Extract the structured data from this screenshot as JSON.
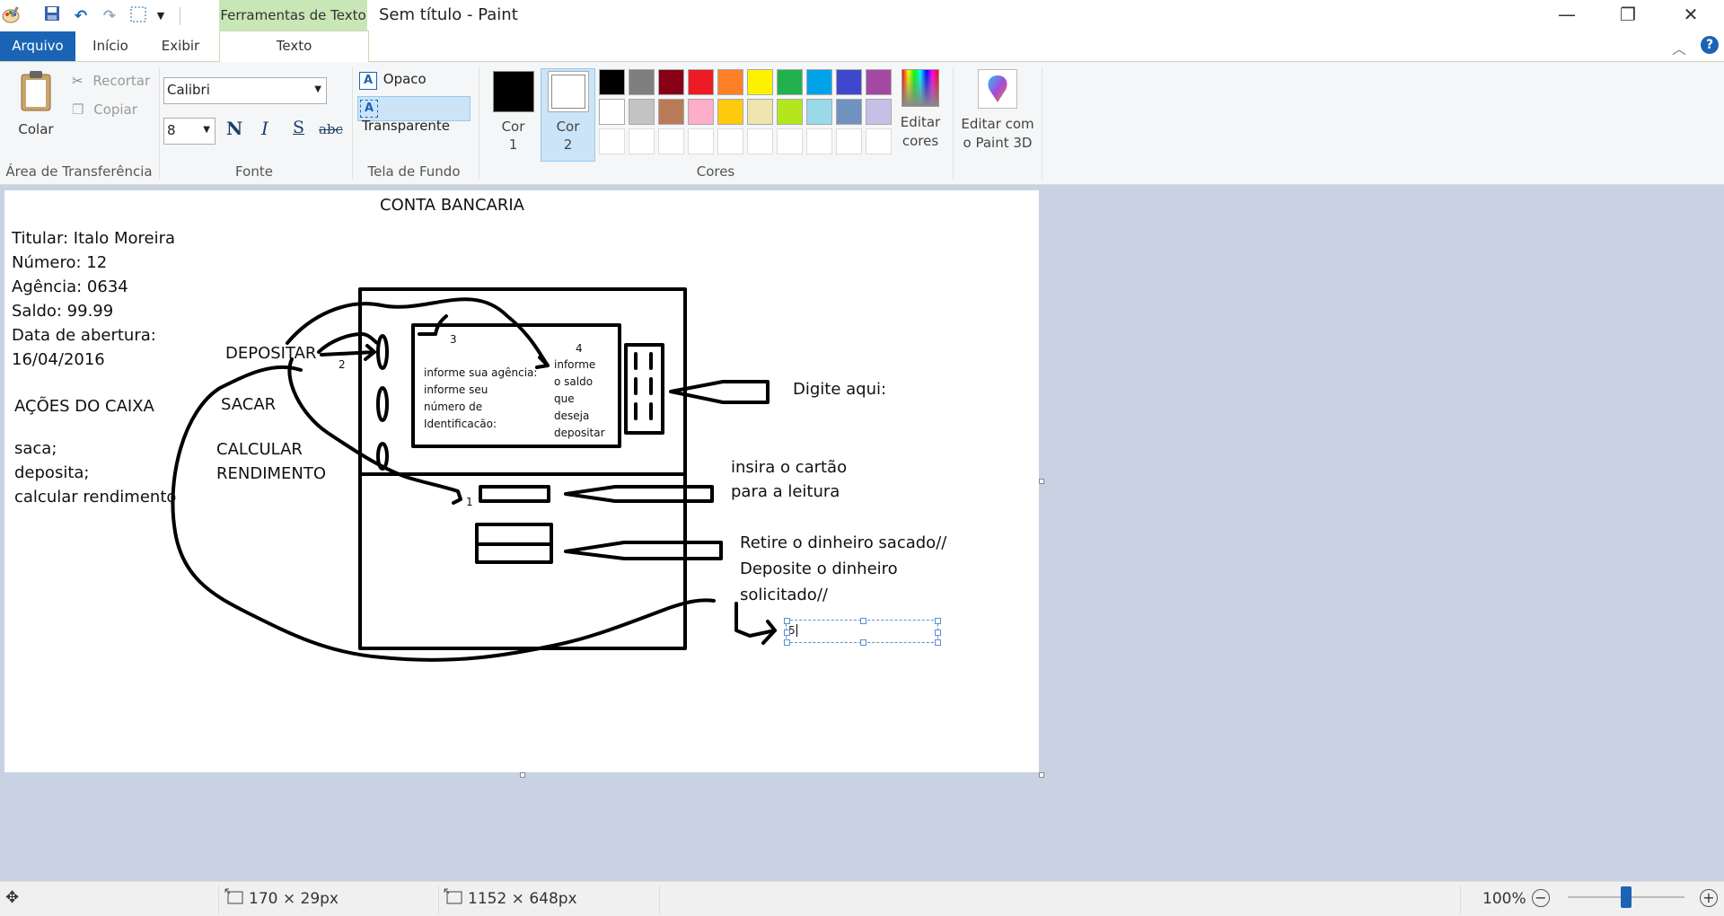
{
  "window": {
    "title": "Sem título - Paint",
    "context_tab_header": "Ferramentas de Texto",
    "buttons": {
      "minimize": "—",
      "restore": "❐",
      "close": "✕"
    }
  },
  "tabs": {
    "file": "Arquivo",
    "home": "Início",
    "view": "Exibir",
    "text": "Texto"
  },
  "clipboard": {
    "paste": "Colar",
    "cut": "Recortar",
    "copy": "Copiar",
    "group_label": "Área de Transferência"
  },
  "font": {
    "family": "Calibri",
    "size": "8",
    "bold": "N",
    "italic": "I",
    "underline": "S",
    "strike": "abc",
    "group_label": "Fonte"
  },
  "background": {
    "opaque": "Opaco",
    "transparent": "Transparente",
    "group_label": "Tela de Fundo"
  },
  "colors": {
    "color1_label_l1": "Cor",
    "color1_label_l2": "1",
    "color2_label_l1": "Cor",
    "color2_label_l2": "2",
    "color1": "#000000",
    "color2": "#ffffff",
    "palette_row1": [
      "#000000",
      "#7f7f7f",
      "#880015",
      "#ed1c24",
      "#ff7f27",
      "#fff200",
      "#22b14c",
      "#00a2e8",
      "#3f48cc",
      "#a349a4"
    ],
    "palette_row2": [
      "#ffffff",
      "#c3c3c3",
      "#b97a57",
      "#ffaec9",
      "#ffc90e",
      "#efe4b0",
      "#b5e61d",
      "#99d9ea",
      "#7092be",
      "#c8bfe7"
    ],
    "edit_colors_l1": "Editar",
    "edit_colors_l2": "cores",
    "group_label": "Cores"
  },
  "paint3d": {
    "label_l1": "Editar com",
    "label_l2": "o Paint 3D"
  },
  "canvas_text": {
    "title": "CONTA BANCARIA",
    "titular": "Titular: Italo Moreira",
    "numero": "Número: 12",
    "agencia": "Agência: 0634",
    "saldo": "Saldo: 99.99",
    "data_label": "Data de abertura:",
    "data_value": "16/04/2016",
    "acoes": "AÇÕES DO CAIXA",
    "saca": "saca;",
    "deposita": "deposita;",
    "calcular": "calcular rendimento",
    "depositar": "DEPOSITAR",
    "sacar": "SACAR",
    "calc1": "CALCULAR",
    "calc2": "RENDIMENTO",
    "n1": "1",
    "n2": "2",
    "n3": "3",
    "n4": "4",
    "screen_left": [
      "informe sua agência:",
      "informe seu",
      "número de",
      "Identificacão:"
    ],
    "screen_right": [
      "informe",
      "o saldo",
      "que",
      "deseja",
      "depositar"
    ],
    "digite": "Digite aqui:",
    "insira1": "insira o cartão",
    "insira2": "para a leitura",
    "retire1": "Retire o dinheiro sacado//",
    "retire2": "Deposite o dinheiro",
    "retire3": "solicitado//",
    "textbox_value": "5"
  },
  "status": {
    "selection_size": "170 × 29px",
    "canvas_size": "1152 × 648px",
    "zoom": "100%",
    "zoom_level": 0.5
  }
}
